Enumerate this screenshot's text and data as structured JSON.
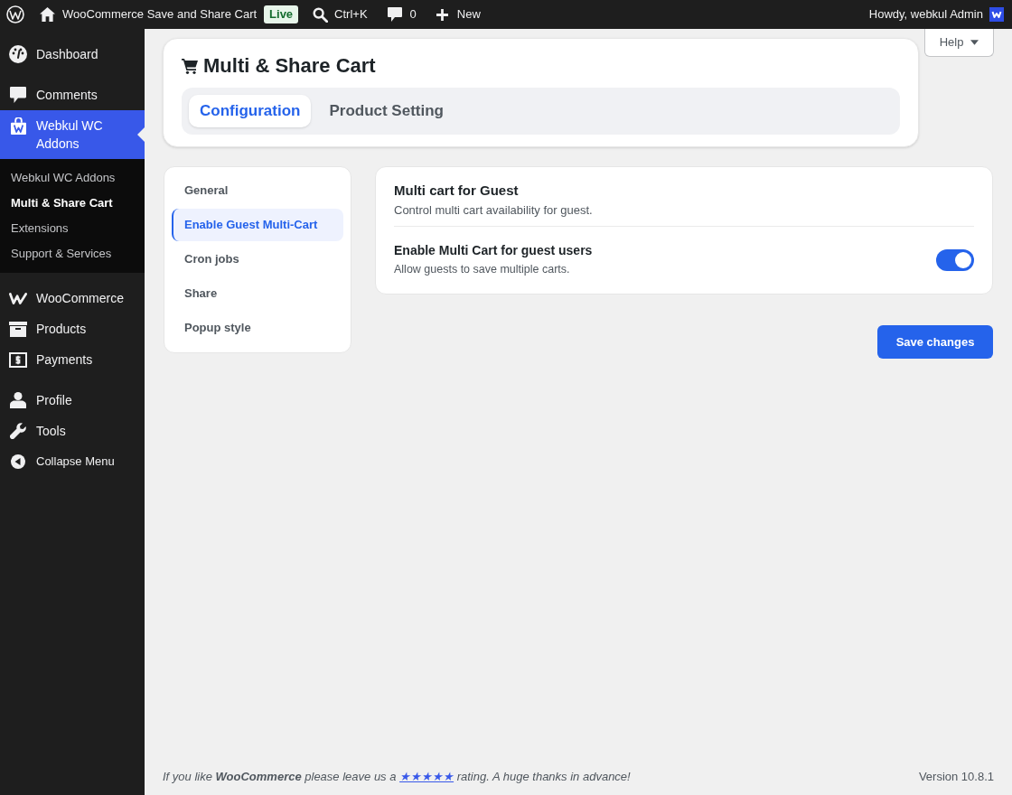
{
  "admin_bar": {
    "site_name": "WooCommerce Save and Share Cart",
    "status_badge": "Live",
    "search_shortcut": "Ctrl+K",
    "comment_count": "0",
    "new_label": "New",
    "greeting": "Howdy, webkul Admin"
  },
  "sidebar": {
    "groups": [
      {
        "items": [
          {
            "label": "Dashboard",
            "selected": false
          }
        ]
      },
      {
        "items": [
          {
            "label": "Comments",
            "selected": false
          },
          {
            "label": "Webkul WC Addons",
            "selected": true,
            "children": [
              {
                "label": "Webkul WC Addons",
                "selected": false
              },
              {
                "label": "Multi & Share Cart",
                "selected": true
              },
              {
                "label": "Extensions",
                "selected": false
              },
              {
                "label": "Support & Services",
                "selected": false
              }
            ]
          }
        ]
      },
      {
        "items": [
          {
            "label": "WooCommerce",
            "selected": false
          },
          {
            "label": "Products",
            "selected": false
          },
          {
            "label": "Payments",
            "selected": false
          }
        ]
      },
      {
        "items": [
          {
            "label": "Profile",
            "selected": false
          },
          {
            "label": "Tools",
            "selected": false
          }
        ]
      }
    ],
    "collapse_label": "Collapse Menu"
  },
  "help_tab": {
    "label": "Help"
  },
  "header": {
    "title": "Multi & Share Cart",
    "tabs": [
      {
        "label": "Configuration",
        "selected": true
      },
      {
        "label": "Product Setting",
        "selected": false
      }
    ]
  },
  "settings_nav": {
    "items": [
      {
        "label": "General",
        "selected": false
      },
      {
        "label": "Enable Guest Multi-Cart",
        "selected": true
      },
      {
        "label": "Cron jobs",
        "selected": false
      },
      {
        "label": "Share",
        "selected": false
      },
      {
        "label": "Popup style",
        "selected": false
      }
    ]
  },
  "section": {
    "title": "Multi cart for Guest",
    "description": "Control multi cart availability for guest.",
    "options": [
      {
        "label": "Enable Multi Cart for guest users",
        "description": "Allow guests to save multiple carts.",
        "on": true
      }
    ]
  },
  "save_button": {
    "label": "Save changes"
  },
  "footer": {
    "text_before": "If you like **WooCommerce** please leave us a",
    "link": "★★★★★",
    "text_after": "rating. A huge thanks in advance!",
    "version": "Version 10.8.1"
  }
}
